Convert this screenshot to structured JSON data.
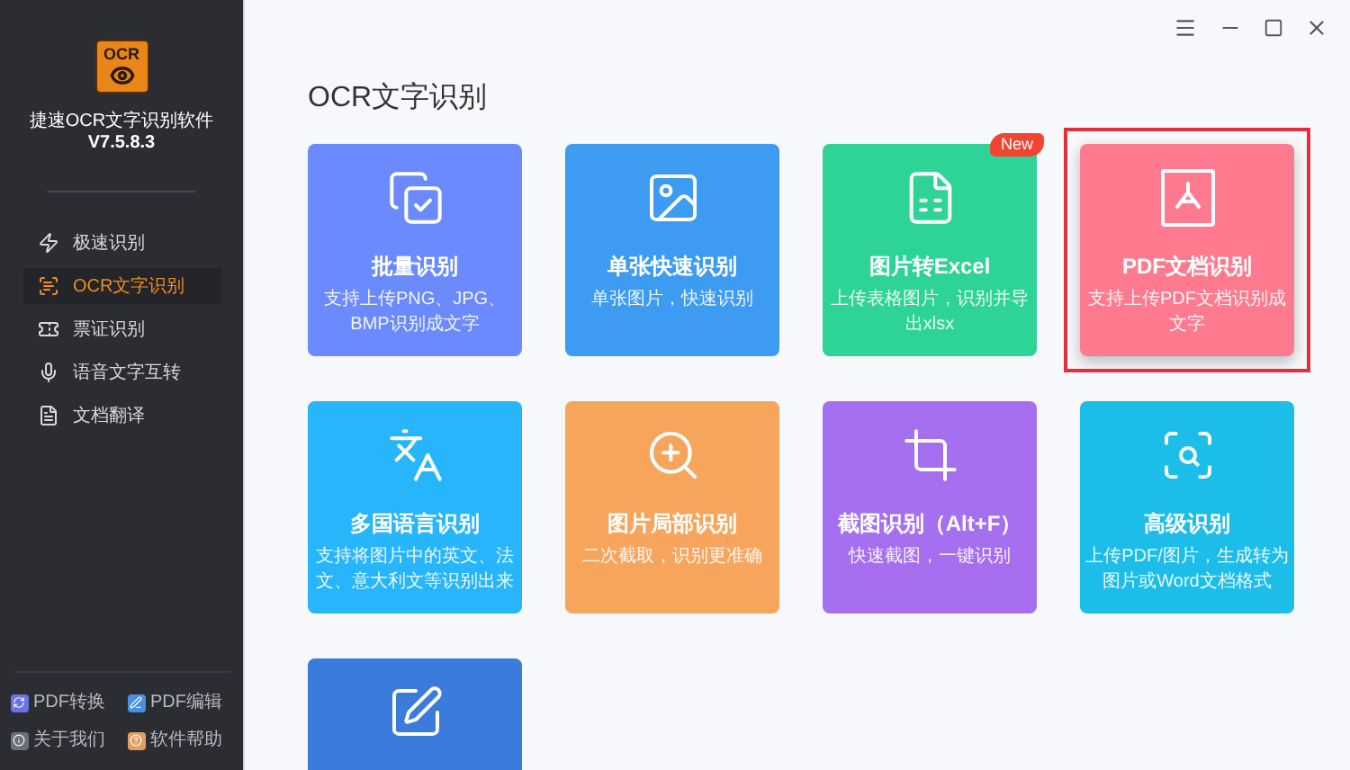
{
  "app": {
    "logo_text": "OCR",
    "name": "捷速OCR文字识别软件",
    "version": "V7.5.8.3"
  },
  "sidebar": {
    "items": [
      {
        "label": "极速识别",
        "selected": false,
        "kind": "fast"
      },
      {
        "label": "OCR文字识别",
        "selected": true,
        "kind": "ocr"
      },
      {
        "label": "票证识别",
        "selected": false,
        "kind": "ticket"
      },
      {
        "label": "语音文字互转",
        "selected": false,
        "kind": "voice"
      },
      {
        "label": "文档翻译",
        "selected": false,
        "kind": "translate"
      }
    ],
    "footer": [
      {
        "label": "PDF转换",
        "color": "#6b72e8"
      },
      {
        "label": "PDF编辑",
        "color": "#4a90e2"
      },
      {
        "label": "关于我们",
        "color": "#6b6f78"
      },
      {
        "label": "软件帮助",
        "color": "#e0a060"
      }
    ]
  },
  "main": {
    "title": "OCR文字识别",
    "cards": [
      {
        "kind": "batch",
        "title": "批量识别",
        "desc": "支持上传PNG、JPG、BMP识别成文字",
        "color": "#6b8afd",
        "selected": false
      },
      {
        "kind": "image",
        "title": "单张快速识别",
        "desc": "单张图片，快速识别",
        "color": "#3d9bf2",
        "selected": false
      },
      {
        "kind": "excel",
        "title": "图片转Excel",
        "desc": "上传表格图片，识别并导出xlsx",
        "color": "#2ed397",
        "selected": false,
        "badge": "New"
      },
      {
        "kind": "pdf",
        "title": "PDF文档识别",
        "desc": "支持上传PDF文档识别成文字",
        "color": "#ff7a8f",
        "selected": true
      },
      {
        "kind": "language",
        "title": "多国语言识别",
        "desc": "支持将图片中的英文、法文、意大利文等识别出来",
        "color": "#27b5fb",
        "selected": false
      },
      {
        "kind": "zoom",
        "title": "图片局部识别",
        "desc": "二次截取，识别更准确",
        "color": "#f7a55c",
        "selected": false
      },
      {
        "kind": "crop",
        "title": "截图识别（Alt+F）",
        "desc": "快速截图，一键识别",
        "color": "#a56ff0",
        "selected": false
      },
      {
        "kind": "scan",
        "title": "高级识别",
        "desc": "上传PDF/图片，生成转为图片或Word文档格式",
        "color": "#1dbde9",
        "selected": false
      },
      {
        "kind": "edit",
        "color": "#3a7bdc",
        "selected": false
      }
    ]
  }
}
